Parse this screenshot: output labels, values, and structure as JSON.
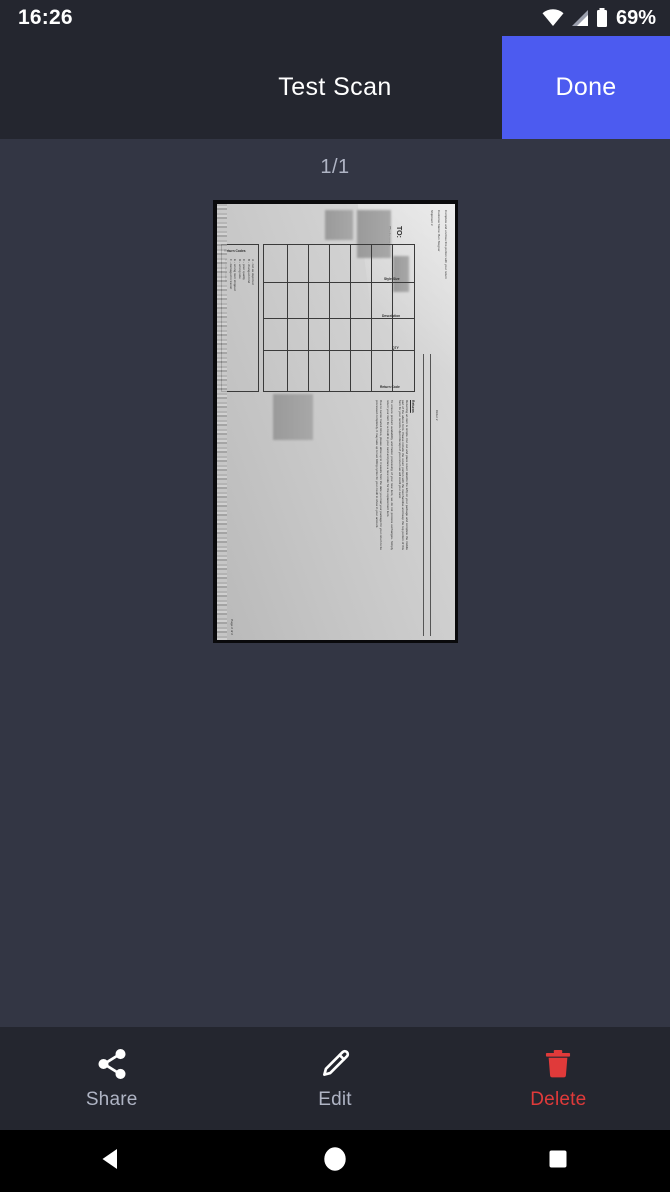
{
  "status_bar": {
    "time": "16:26",
    "battery_percent": "69%",
    "icons": [
      "wifi-icon",
      "cellular-signal-icon",
      "battery-icon"
    ]
  },
  "app_bar": {
    "title": "Test Scan",
    "done_label": "Done",
    "done_color": "#4C5BF0"
  },
  "content": {
    "page_indicator": "1/1",
    "background_color": "#333644"
  },
  "scan": {
    "header_lines": [
      "Complete and enclose this portion with your return",
      "Customer Name: Ben Stegner",
      "Shipment #"
    ],
    "order_label": "Order #",
    "page_label": "Page 2 of 2",
    "address_label": "TO:",
    "address_lines": [
      "Returns",
      "Center"
    ],
    "table_headers": [
      "Style-Size",
      "Description",
      "QTY",
      "Return Code"
    ],
    "codes_title": "Return Codes",
    "codes": [
      "A - not as depicted",
      "B - changed mind",
      "C - poor quality",
      "D - wrong size",
      "E - wrong item shipped",
      "F - damaged in transit",
      "G - other reason"
    ],
    "returns_heading": "Returns",
    "returns_paragraphs": [
      "Returning an item is simple. Cut out and place return label/to the left) on your package and complete the middle part of the above form. Please include the return portion with the merchandise and keep the top portion of this form for your records. Upon Receipt of your return we will credit your card.",
      "To ensure product availability and faster processing of your new item, we do not process exchanges. Simply return your item for a credit to your card and place a new order for the replacement item.",
      "Due to carrier transit times, please allow up to 3 weeks from the date you mail your package for your return to be processed completely. It may take up to two billing cycles for your credit to show in your account."
    ]
  },
  "toolbar": {
    "items": [
      {
        "label": "Share",
        "icon": "share-icon",
        "color": "#AFB4C4"
      },
      {
        "label": "Edit",
        "icon": "pencil-icon",
        "color": "#AFB4C4"
      },
      {
        "label": "Delete",
        "icon": "trash-icon",
        "color": "#E03A3A"
      }
    ]
  },
  "nav_bar": {
    "back": "back-triangle-icon",
    "home": "home-circle-icon",
    "recents": "recents-square-icon"
  }
}
